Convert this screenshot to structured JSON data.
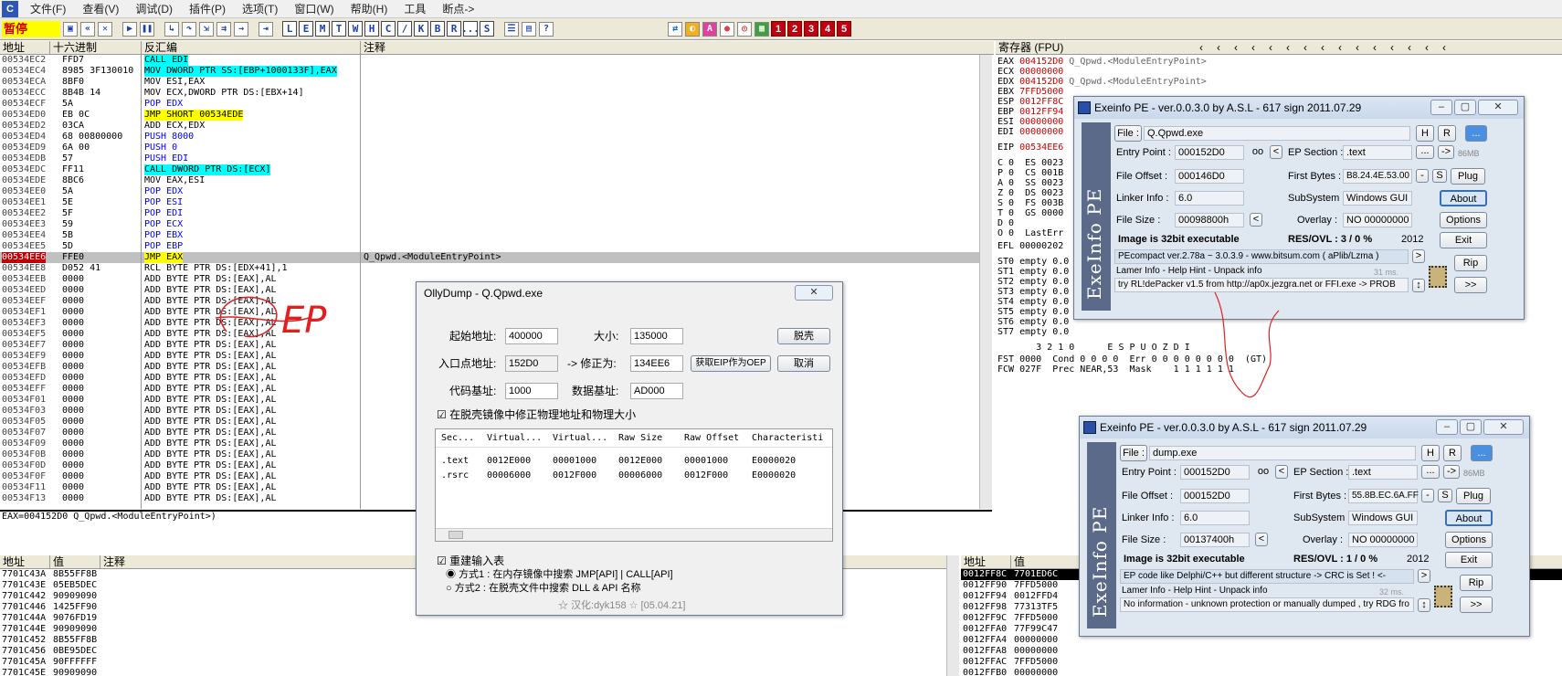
{
  "menu": {
    "app_icon": "C",
    "items": [
      "文件(F)",
      "查看(V)",
      "调试(D)",
      "插件(P)",
      "选项(T)",
      "窗口(W)",
      "帮助(H)",
      "工具",
      "断点->"
    ]
  },
  "toolbar": {
    "status": "暂停",
    "letters": [
      "L",
      "E",
      "M",
      "T",
      "W",
      "H",
      "C",
      "/",
      "K",
      "B",
      "R",
      "...",
      "S"
    ],
    "numbers": [
      "1",
      "2",
      "3",
      "4",
      "5"
    ]
  },
  "cpu": {
    "headers": {
      "addr": "地址",
      "hex": "十六进制",
      "disasm": "反汇编",
      "comment": "注释"
    },
    "rows": [
      {
        "a": "00534EC2",
        "h": "FFD7",
        "d": "CALL EDI",
        "c": ""
      },
      {
        "a": "00534EC4",
        "h": "8985 3F130010",
        "d": "MOV DWORD PTR SS:[EBP+1000133F],EAX",
        "c": ""
      },
      {
        "a": "00534ECA",
        "h": "8BF0",
        "d": "MOV ESI,EAX",
        "c": ""
      },
      {
        "a": "00534ECC",
        "h": "8B4B 14",
        "d": "MOV ECX,DWORD PTR DS:[EBX+14]",
        "c": ""
      },
      {
        "a": "00534ECF",
        "h": "5A",
        "d": "POP EDX",
        "c": ""
      },
      {
        "a": "00534ED0",
        "h": "EB 0C",
        "d": "JMP SHORT 00534EDE",
        "c": ""
      },
      {
        "a": "00534ED2",
        "h": "03CA",
        "d": "ADD ECX,EDX",
        "c": ""
      },
      {
        "a": "00534ED4",
        "h": "68 00800000",
        "d": "PUSH 8000",
        "c": ""
      },
      {
        "a": "00534ED9",
        "h": "6A 00",
        "d": "PUSH 0",
        "c": ""
      },
      {
        "a": "00534EDB",
        "h": "57",
        "d": "PUSH EDI",
        "c": ""
      },
      {
        "a": "00534EDC",
        "h": "FF11",
        "d": "CALL DWORD PTR DS:[ECX]",
        "c": ""
      },
      {
        "a": "00534EDE",
        "h": "8BC6",
        "d": "MOV EAX,ESI",
        "c": ""
      },
      {
        "a": "00534EE0",
        "h": "5A",
        "d": "POP EDX",
        "c": ""
      },
      {
        "a": "00534EE1",
        "h": "5E",
        "d": "POP ESI",
        "c": ""
      },
      {
        "a": "00534EE2",
        "h": "5F",
        "d": "POP EDI",
        "c": ""
      },
      {
        "a": "00534EE3",
        "h": "59",
        "d": "POP ECX",
        "c": ""
      },
      {
        "a": "00534EE4",
        "h": "5B",
        "d": "POP EBX",
        "c": ""
      },
      {
        "a": "00534EE5",
        "h": "5D",
        "d": "POP EBP",
        "c": ""
      },
      {
        "a": "00534EE6",
        "h": "FFE0",
        "d": "JMP EAX",
        "c": "Q_Qpwd.<ModuleEntryPoint>"
      },
      {
        "a": "00534EE8",
        "h": "D052 41",
        "d": "RCL BYTE PTR DS:[EDX+41],1",
        "c": ""
      },
      {
        "a": "00534EEB",
        "h": "0000",
        "d": "ADD BYTE PTR DS:[EAX],AL",
        "c": ""
      },
      {
        "a": "00534EED",
        "h": "0000",
        "d": "ADD BYTE PTR DS:[EAX],AL",
        "c": ""
      },
      {
        "a": "00534EEF",
        "h": "0000",
        "d": "ADD BYTE PTR DS:[EAX],AL",
        "c": ""
      },
      {
        "a": "00534EF1",
        "h": "0000",
        "d": "ADD BYTE PTR DS:[EAX],AL",
        "c": ""
      },
      {
        "a": "00534EF3",
        "h": "0000",
        "d": "ADD BYTE PTR DS:[EAX],AL",
        "c": ""
      },
      {
        "a": "00534EF5",
        "h": "0000",
        "d": "ADD BYTE PTR DS:[EAX],AL",
        "c": ""
      },
      {
        "a": "00534EF7",
        "h": "0000",
        "d": "ADD BYTE PTR DS:[EAX],AL",
        "c": ""
      },
      {
        "a": "00534EF9",
        "h": "0000",
        "d": "ADD BYTE PTR DS:[EAX],AL",
        "c": ""
      },
      {
        "a": "00534EFB",
        "h": "0000",
        "d": "ADD BYTE PTR DS:[EAX],AL",
        "c": ""
      },
      {
        "a": "00534EFD",
        "h": "0000",
        "d": "ADD BYTE PTR DS:[EAX],AL",
        "c": ""
      },
      {
        "a": "00534EFF",
        "h": "0000",
        "d": "ADD BYTE PTR DS:[EAX],AL",
        "c": ""
      },
      {
        "a": "00534F01",
        "h": "0000",
        "d": "ADD BYTE PTR DS:[EAX],AL",
        "c": ""
      },
      {
        "a": "00534F03",
        "h": "0000",
        "d": "ADD BYTE PTR DS:[EAX],AL",
        "c": ""
      },
      {
        "a": "00534F05",
        "h": "0000",
        "d": "ADD BYTE PTR DS:[EAX],AL",
        "c": ""
      },
      {
        "a": "00534F07",
        "h": "0000",
        "d": "ADD BYTE PTR DS:[EAX],AL",
        "c": ""
      },
      {
        "a": "00534F09",
        "h": "0000",
        "d": "ADD BYTE PTR DS:[EAX],AL",
        "c": ""
      },
      {
        "a": "00534F0B",
        "h": "0000",
        "d": "ADD BYTE PTR DS:[EAX],AL",
        "c": ""
      },
      {
        "a": "00534F0D",
        "h": "0000",
        "d": "ADD BYTE PTR DS:[EAX],AL",
        "c": ""
      },
      {
        "a": "00534F0F",
        "h": "0000",
        "d": "ADD BYTE PTR DS:[EAX],AL",
        "c": ""
      },
      {
        "a": "00534F11",
        "h": "0000",
        "d": "ADD BYTE PTR DS:[EAX],AL",
        "c": ""
      },
      {
        "a": "00534F13",
        "h": "0000",
        "d": "ADD BYTE PTR DS:[EAX],AL",
        "c": ""
      }
    ],
    "info_line": "EAX=004152D0  Q_Qpwd.<ModuleEntryPoint>)",
    "annotation": "EP"
  },
  "registers": {
    "header": "寄存器 (FPU)",
    "general": [
      {
        "name": "EAX",
        "val": "004152D0",
        "note": "Q_Qpwd.<ModuleEntryPoint>"
      },
      {
        "name": "ECX",
        "val": "00000000",
        "note": ""
      },
      {
        "name": "EDX",
        "val": "004152D0",
        "note": "Q_Qpwd.<ModuleEntryPoint>"
      },
      {
        "name": "EBX",
        "val": "7FFD5000",
        "note": ""
      },
      {
        "name": "ESP",
        "val": "0012FF8C",
        "note": ""
      },
      {
        "name": "EBP",
        "val": "0012FF94",
        "note": ""
      },
      {
        "name": "ESI",
        "val": "00000000",
        "note": ""
      },
      {
        "name": "EDI",
        "val": "00000000",
        "note": ""
      }
    ],
    "eip": {
      "name": "EIP",
      "val": "00534EE6"
    },
    "flags": [
      "C 0  ES 0023",
      "P 0  CS 001B",
      "A 0  SS 0023",
      "Z 0  DS 0023",
      "S 0  FS 003B",
      "T 0  GS 0000",
      "D 0",
      "O 0  LastErr"
    ],
    "efl": "EFL 00000202",
    "fpu": [
      "ST0 empty 0.0",
      "ST1 empty 0.0",
      "ST2 empty 0.0",
      "ST3 empty 0.0",
      "ST4 empty 0.0",
      "ST5 empty 0.0",
      "ST6 empty 0.0",
      "ST7 empty 0.0"
    ],
    "fpu_bits_header": "       3 2 1 0      E S P U O Z D I",
    "fst": "FST 0000  Cond 0 0 0 0  Err 0 0 0 0 0 0 0 0  (GT)",
    "fcw": "FCW 027F  Prec NEAR,53  Mask    1 1 1 1 1 1"
  },
  "dump": {
    "headers": {
      "addr": "地址",
      "val": "值",
      "comment": "注释"
    },
    "rows": [
      {
        "a": "7701C43A",
        "v": "8B55FF8B"
      },
      {
        "a": "7701C43E",
        "v": "05EB5DEC"
      },
      {
        "a": "7701C442",
        "v": "90909090"
      },
      {
        "a": "7701C446",
        "v": "1425FF90"
      },
      {
        "a": "7701C44A",
        "v": "9076FD19"
      },
      {
        "a": "7701C44E",
        "v": "90909090"
      },
      {
        "a": "7701C452",
        "v": "8B55FF8B"
      },
      {
        "a": "7701C456",
        "v": "0BE95DEC"
      },
      {
        "a": "7701C45A",
        "v": "90FFFFFF"
      },
      {
        "a": "7701C45E",
        "v": "90909090"
      }
    ]
  },
  "stack": {
    "headers": {
      "addr": "地址",
      "val": "值"
    },
    "rows": [
      {
        "a": "0012FF8C",
        "v": "7701ED6C"
      },
      {
        "a": "0012FF90",
        "v": "7FFD5000"
      },
      {
        "a": "0012FF94",
        "v": "0012FFD4"
      },
      {
        "a": "0012FF98",
        "v": "77313TF5"
      },
      {
        "a": "0012FF9C",
        "v": "7FFD5000"
      },
      {
        "a": "0012FFA0",
        "v": "77F99C47"
      },
      {
        "a": "0012FFA4",
        "v": "00000000"
      },
      {
        "a": "0012FFA8",
        "v": "00000000"
      },
      {
        "a": "0012FFAC",
        "v": "7FFD5000"
      },
      {
        "a": "0012FFB0",
        "v": "00000000"
      }
    ]
  },
  "ollydump": {
    "title": "OllyDump - Q.Qpwd.exe",
    "close": "✕",
    "start_label": "起始地址:",
    "start_val": "400000",
    "size_label": "大小:",
    "size_val": "135000",
    "dump_btn": "脱壳",
    "entry_label": "入口点地址:",
    "entry_val": "152D0",
    "fix_label": "-> 修正为:",
    "fix_val": "134EE6",
    "get_eip_btn": "获取EIP作为OEP",
    "cancel_btn": "取消",
    "code_label": "代码基址:",
    "code_val": "1000",
    "data_label": "数据基址:",
    "data_val": "AD000",
    "fix_check": "在脱壳镜像中修正物理地址和物理大小",
    "section_headers": [
      "Sec...",
      "Virtual...",
      "Virtual...",
      "Raw Size",
      "Raw Offset",
      "Characteristi"
    ],
    "sections": [
      [
        ".text",
        "0012E000",
        "00001000",
        "0012E000",
        "00001000",
        "E0000020"
      ],
      [
        ".rsrc",
        "00006000",
        "0012F000",
        "00006000",
        "0012F000",
        "E0000020"
      ]
    ],
    "rebuild_check": "重建输入表",
    "method1": "方式1 : 在内存镜像中搜索 JMP[API] | CALL[API]",
    "method2": "方式2 : 在脱壳文件中搜索 DLL & API 名称",
    "credit": "☆ 汉化:dyk158 ☆ [05.04.21]"
  },
  "exeinfo1": {
    "title": "Exeinfo PE - ver.0.0.3.0  by A.S.L -  617 sign 2011.07.29",
    "brand": "ExeInfo PE",
    "file_btn": "File :",
    "file_name": "Q.Qpwd.exe",
    "entry_label": "Entry Point :",
    "entry_val": "000152D0",
    "oo": "oo",
    "ep_section_label": "EP Section :",
    "ep_section_val": ".text",
    "offset_label": "File Offset :",
    "offset_val": "000146D0",
    "first_bytes_label": "First Bytes :",
    "first_bytes_val": "B8.24.4E.53.00",
    "linker_label": "Linker Info :",
    "linker_val": "6.0",
    "subsystem_label": "SubSystem :",
    "subsystem_val": "Windows GUI",
    "size_label": "File Size :",
    "size_val": "00098800h",
    "overlay_label": "Overlay :",
    "overlay_val": "NO  00000000",
    "is32": "Image is 32bit executable",
    "resovl": "RES/OVL : 3 / 0 %",
    "year": "2012",
    "detect": "PEcompact ver.2.78a ~ 3.0.3.9  - www.bitsum.com ( aPlib/Lzma )",
    "lamer": "Lamer Info - Help Hint - Unpack info",
    "ms": "31 ms.",
    "unpack": "try RL!dePacker v1.5 from http://ap0x.jezgra.net or FFI.exe -> PROB",
    "mb": "86MB",
    "btn_h": "H",
    "btn_r": "R",
    "btn_dots": "...",
    "btn_plug": "Plug",
    "btn_about": "About",
    "btn_options": "Options",
    "btn_exit": "Exit",
    "btn_rip": "Rip",
    "btn_next": ">>",
    "btn_s": "S"
  },
  "exeinfo2": {
    "title": "Exeinfo PE - ver.0.0.3.0  by A.S.L -  617 sign 2011.07.29",
    "brand": "ExeInfo PE",
    "file_btn": "File :",
    "file_name": "dump.exe",
    "entry_label": "Entry Point :",
    "entry_val": "000152D0",
    "oo": "oo",
    "ep_section_label": "EP Section :",
    "ep_section_val": ".text",
    "offset_label": "File Offset :",
    "offset_val": "000152D0",
    "first_bytes_label": "First Bytes :",
    "first_bytes_val": "55.8B.EC.6A.FF",
    "linker_label": "Linker Info :",
    "linker_val": "6.0",
    "subsystem_label": "SubSystem :",
    "subsystem_val": "Windows GUI",
    "size_label": "File Size :",
    "size_val": "00137400h",
    "overlay_label": "Overlay :",
    "overlay_val": "NO  00000000",
    "is32": "Image is 32bit executable",
    "resovl": "RES/OVL : 1 / 0 %",
    "year": "2012",
    "detect": "EP code like Delphi/C++ but different structure -> CRC is Set ! <-",
    "lamer": "Lamer Info - Help Hint - Unpack info",
    "ms": "32 ms.",
    "unpack": "No information - unknown protection or manually dumped , try RDG fro",
    "mb": "86MB",
    "btn_h": "H",
    "btn_r": "R",
    "btn_dots": "...",
    "btn_plug": "Plug",
    "btn_about": "About",
    "btn_options": "Options",
    "btn_exit": "Exit",
    "btn_rip": "Rip",
    "btn_next": ">>",
    "btn_s": "S"
  },
  "colors": {
    "accent_red": "#c00010",
    "highlight_yellow": "#ffff00",
    "highlight_cyan": "#00ffff",
    "exeinfo_bar": "#5b6a89"
  }
}
